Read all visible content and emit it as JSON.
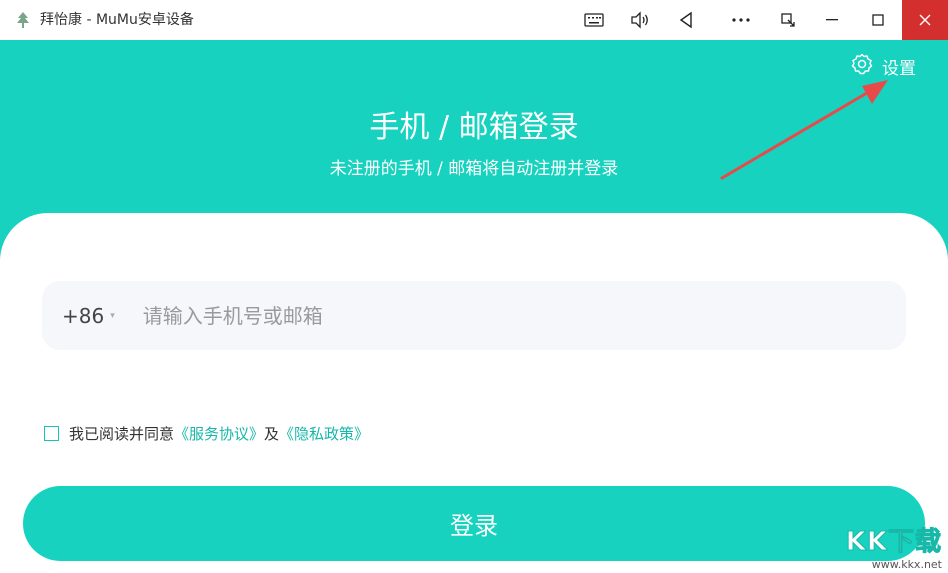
{
  "window": {
    "title": "拜怡康 - MuMu安卓设备",
    "icon": "tree-icon",
    "buttons": [
      "keyboard-icon",
      "volume-icon",
      "back-icon",
      "more-icon",
      "rotate-icon",
      "minimize-icon",
      "maximize-icon",
      "close-icon"
    ]
  },
  "header": {
    "settings_label": "设置",
    "title": "手机 / 邮箱登录",
    "subtitle": "未注册的手机 / 邮箱将自动注册并登录"
  },
  "form": {
    "country_code": "+86",
    "phone_placeholder": "请输入手机号或邮箱",
    "agree_prefix": "我已阅读并同意",
    "service_link": "《服务协议》",
    "and_text": "及",
    "privacy_link": "《隐私政策》",
    "login_label": "登录"
  },
  "watermark": {
    "logo": "KK下载",
    "url": "www.kkx.net"
  },
  "colors": {
    "accent": "#16d2bf",
    "close": "#d32f2f",
    "annotation_arrow": "#e84a4a"
  }
}
